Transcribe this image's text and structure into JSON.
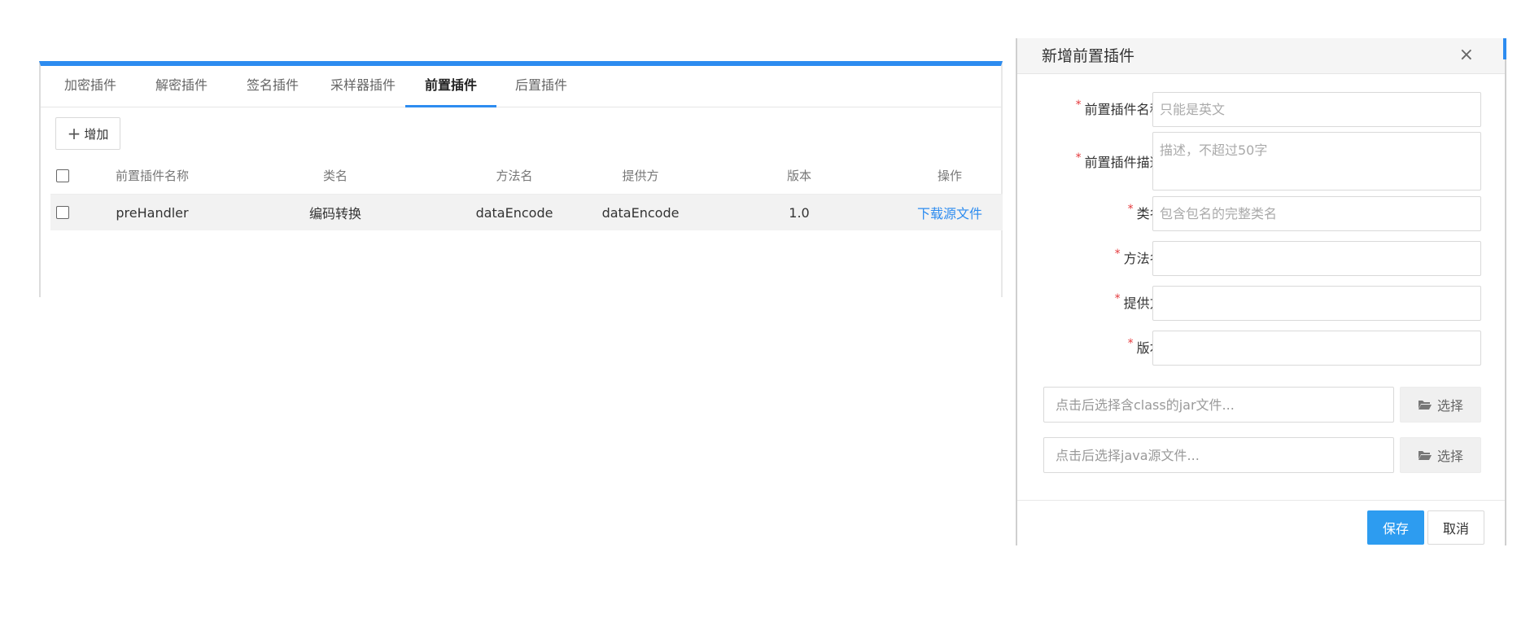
{
  "tabs": [
    {
      "label": "加密插件"
    },
    {
      "label": "解密插件"
    },
    {
      "label": "签名插件"
    },
    {
      "label": "采样器插件"
    },
    {
      "label": "前置插件",
      "active": true
    },
    {
      "label": "后置插件"
    }
  ],
  "toolbar": {
    "add_label": "增加"
  },
  "table": {
    "columns": [
      "前置插件名称",
      "类名",
      "方法名",
      "提供方",
      "版本",
      "操作"
    ],
    "rows": [
      {
        "name": "preHandler",
        "class_name": "编码转换",
        "method": "dataEncode",
        "provider": "dataEncode",
        "version": "1.0",
        "action": "下载源文件"
      }
    ]
  },
  "dialog": {
    "title": "新增前置插件",
    "close": "×",
    "fields": {
      "name": {
        "label": "前置插件名称:",
        "placeholder": "只能是英文",
        "value": ""
      },
      "desc": {
        "label": "前置插件描述:",
        "placeholder": "描述，不超过50字",
        "value": ""
      },
      "class_name": {
        "label": "类名:",
        "placeholder": "包含包名的完整类名",
        "value": ""
      },
      "method": {
        "label": "方法名:",
        "placeholder": "",
        "value": ""
      },
      "provider": {
        "label": "提供方:",
        "placeholder": "",
        "value": ""
      },
      "version": {
        "label": "版本:",
        "placeholder": "",
        "value": ""
      }
    },
    "jar_file": {
      "placeholder": "点击后选择含class的jar文件...",
      "button": "选择"
    },
    "java_file": {
      "placeholder": "点击后选择java源文件...",
      "button": "选择"
    },
    "save_label": "保存",
    "cancel_label": "取消"
  },
  "colors": {
    "accent": "#2d8cf0",
    "required": "#e4393c",
    "save_button": "#2d9cf0"
  },
  "icons": {
    "add": "plus-icon",
    "choose": "folder-open-icon",
    "close": "close-icon"
  }
}
